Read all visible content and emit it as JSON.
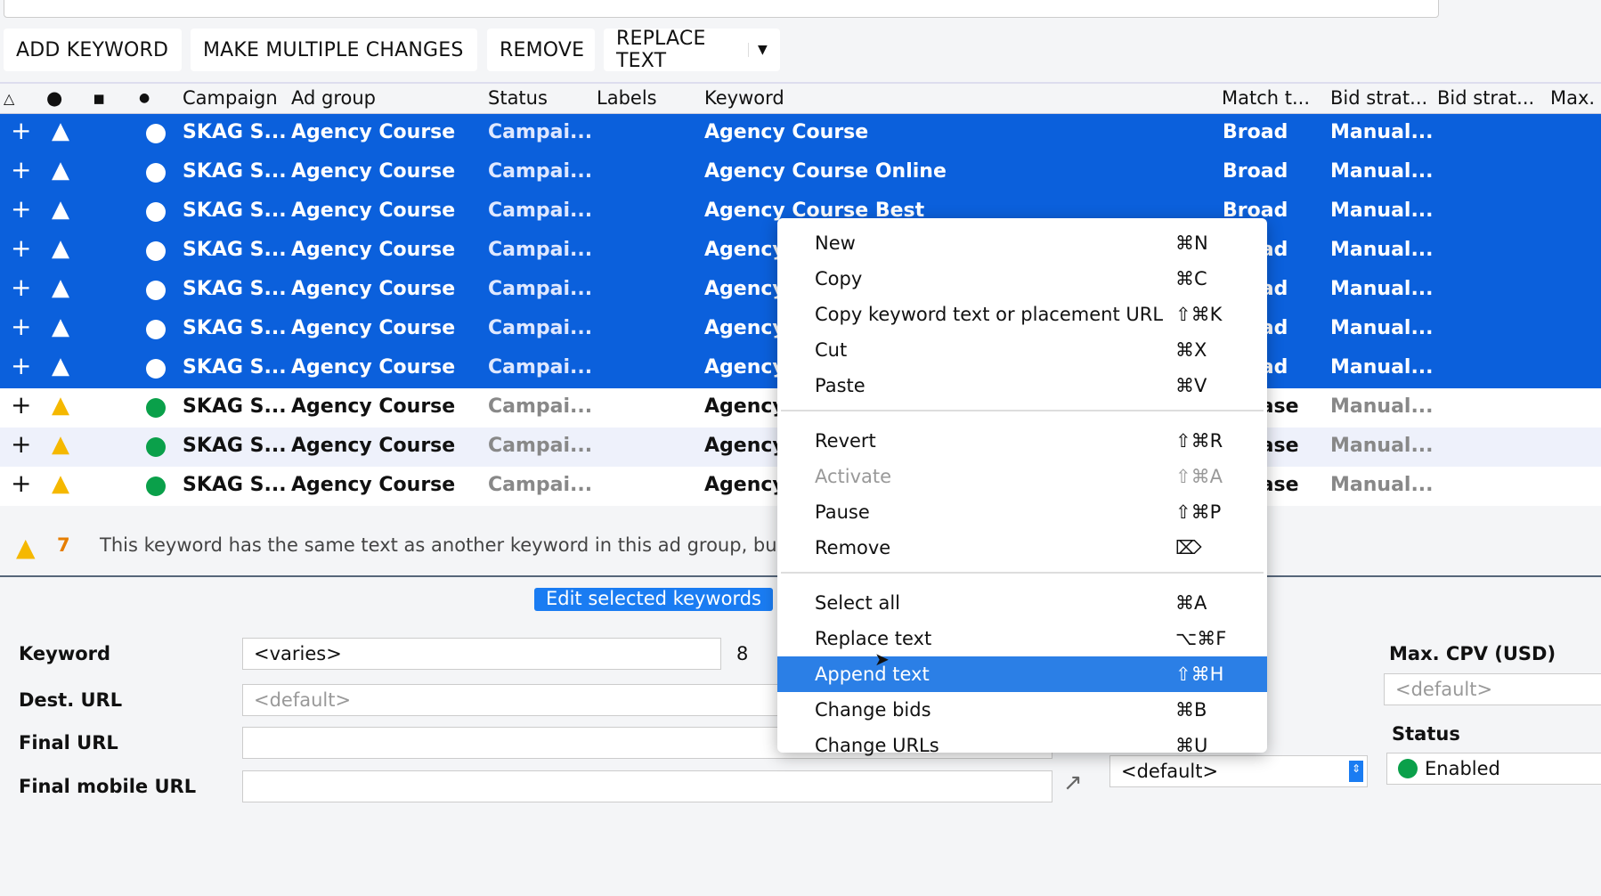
{
  "toolbar": {
    "add_keyword": "ADD KEYWORD",
    "multiple": "MAKE MULTIPLE CHANGES",
    "remove": "REMOVE",
    "replace": "REPLACE TEXT"
  },
  "columns": {
    "campaign": "Campaign",
    "ad_group": "Ad group",
    "status": "Status",
    "labels": "Labels",
    "keyword": "Keyword",
    "match": "Match t...",
    "bid1": "Bid strat...",
    "bid2": "Bid strat...",
    "max": "Max."
  },
  "rows": [
    {
      "campaign": "SKAG S...",
      "ad_group": "Agency Course",
      "status": "Campai...",
      "keyword": "Agency Course",
      "match": "Broad",
      "bid": "Manual...",
      "selected": true
    },
    {
      "campaign": "SKAG S...",
      "ad_group": "Agency Course",
      "status": "Campai...",
      "keyword": "Agency Course Online",
      "match": "Broad",
      "bid": "Manual...",
      "selected": true
    },
    {
      "campaign": "SKAG S...",
      "ad_group": "Agency Course",
      "status": "Campai...",
      "keyword": "Agency Course Best",
      "match": "Broad",
      "bid": "Manual...",
      "selected": true
    },
    {
      "campaign": "SKAG S...",
      "ad_group": "Agency Course",
      "status": "Campai...",
      "keyword": "Agency",
      "match": "Broad",
      "bid": "Manual...",
      "selected": true
    },
    {
      "campaign": "SKAG S...",
      "ad_group": "Agency Course",
      "status": "Campai...",
      "keyword": "Agency",
      "match": "Broad",
      "bid": "Manual...",
      "selected": true
    },
    {
      "campaign": "SKAG S...",
      "ad_group": "Agency Course",
      "status": "Campai...",
      "keyword": "Agency",
      "match": "Broad",
      "bid": "Manual...",
      "selected": true
    },
    {
      "campaign": "SKAG S...",
      "ad_group": "Agency Course",
      "status": "Campai...",
      "keyword": "Agency",
      "match": "Broad",
      "bid": "Manual...",
      "selected": true
    },
    {
      "campaign": "SKAG S...",
      "ad_group": "Agency Course",
      "status": "Campai...",
      "keyword": "Agency",
      "match": "Phrase",
      "bid": "Manual...",
      "selected": false
    },
    {
      "campaign": "SKAG S...",
      "ad_group": "Agency Course",
      "status": "Campai...",
      "keyword": "Agency",
      "match": "Phrase",
      "bid": "Manual...",
      "selected": false
    },
    {
      "campaign": "SKAG S...",
      "ad_group": "Agency Course",
      "status": "Campai...",
      "keyword": "Agency",
      "match": "Phrase",
      "bid": "Manual...",
      "selected": false
    }
  ],
  "warning": {
    "count": "7",
    "text": "This keyword has the same text as another keyword in this ad group, bu"
  },
  "tabs": {
    "edit": "Edit selected keywords"
  },
  "form": {
    "keyword_label": "Keyword",
    "keyword_value": "<varies>",
    "keyword_count": "8",
    "dest_label": "Dest. URL",
    "dest_placeholder": "<default>",
    "final_label": "Final URL",
    "mobile_label": "Final mobile URL",
    "bid_value": "<default>",
    "cpv_label": "Max. CPV (USD)",
    "cpv_placeholder": "<default>",
    "status_label": "Status",
    "status_value": "Enabled"
  },
  "menu": [
    {
      "label": "New",
      "key": "⌘N"
    },
    {
      "label": "Copy",
      "key": "⌘C"
    },
    {
      "label": "Copy keyword text or placement URL",
      "key": "⇧⌘K"
    },
    {
      "label": "Cut",
      "key": "⌘X"
    },
    {
      "label": "Paste",
      "key": "⌘V"
    },
    {
      "sep": true
    },
    {
      "label": "Revert",
      "key": "⇧⌘R"
    },
    {
      "label": "Activate",
      "key": "⇧⌘A",
      "disabled": true
    },
    {
      "label": "Pause",
      "key": "⇧⌘P"
    },
    {
      "label": "Remove",
      "key": "⌦"
    },
    {
      "sep": true
    },
    {
      "label": "Select all",
      "key": "⌘A"
    },
    {
      "label": "Replace text",
      "key": "⌥⌘F"
    },
    {
      "label": "Append text",
      "key": "⇧⌘H",
      "highlighted": true
    },
    {
      "label": "Change bids",
      "key": "⌘B"
    },
    {
      "label": "Change URLs",
      "key": "⌘U"
    }
  ],
  "colors": {
    "selection": "#0b60dc",
    "menu_highlight": "#2b7fe6",
    "enabled": "#0aa04a",
    "warning": "#f5b800"
  }
}
